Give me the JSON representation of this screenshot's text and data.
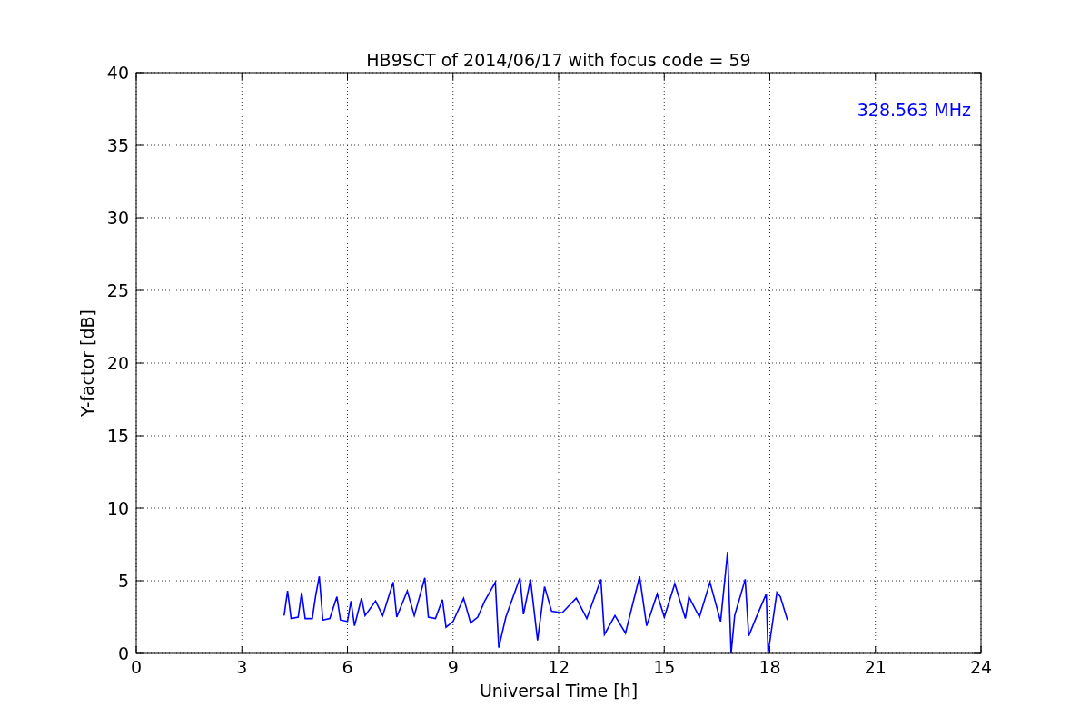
{
  "figure": {
    "chart_data": {
      "type": "line",
      "title": "HB9SCT of 2014/06/17 with focus code = 59",
      "xlabel": "Universal Time [h]",
      "ylabel": "Y-factor [dB]",
      "xlim": [
        0,
        24
      ],
      "ylim": [
        0,
        40
      ],
      "xticks": [
        0,
        3,
        6,
        9,
        12,
        15,
        18,
        21,
        24
      ],
      "yticks": [
        0,
        5,
        10,
        15,
        20,
        25,
        30,
        35,
        40
      ],
      "x": [
        4.2,
        4.3,
        4.4,
        4.6,
        4.7,
        4.8,
        5.0,
        5.1,
        5.2,
        5.3,
        5.5,
        5.7,
        5.8,
        6.0,
        6.1,
        6.2,
        6.4,
        6.5,
        6.8,
        7.0,
        7.3,
        7.4,
        7.7,
        7.9,
        8.2,
        8.3,
        8.5,
        8.7,
        8.8,
        9.0,
        9.3,
        9.5,
        9.7,
        9.9,
        10.2,
        10.3,
        10.5,
        10.9,
        11.0,
        11.2,
        11.4,
        11.6,
        11.8,
        12.1,
        12.5,
        12.8,
        13.2,
        13.3,
        13.6,
        13.9,
        14.3,
        14.5,
        14.8,
        15.0,
        15.3,
        15.6,
        15.7,
        16.0,
        16.3,
        16.6,
        16.8,
        16.9,
        17.0,
        17.3,
        17.4,
        17.6,
        17.9,
        17.95,
        18.1,
        18.2,
        18.3,
        18.5
      ],
      "series": [
        {
          "name": "328.563 MHz",
          "color": "#0000ff",
          "values": [
            2.6,
            4.3,
            2.4,
            2.5,
            4.2,
            2.4,
            2.4,
            4.0,
            5.3,
            2.3,
            2.4,
            3.9,
            2.3,
            2.2,
            3.6,
            1.9,
            3.8,
            2.6,
            3.6,
            2.6,
            4.9,
            2.5,
            4.3,
            2.6,
            5.2,
            2.5,
            2.4,
            3.7,
            1.8,
            2.2,
            3.8,
            2.1,
            2.5,
            3.6,
            4.9,
            0.4,
            2.5,
            5.2,
            2.7,
            5.1,
            0.9,
            4.6,
            2.9,
            2.8,
            3.8,
            2.4,
            5.1,
            1.3,
            2.6,
            1.4,
            5.3,
            1.9,
            4.1,
            2.5,
            4.8,
            2.4,
            3.9,
            2.5,
            4.9,
            2.2,
            7.0,
            0.0,
            2.6,
            5.1,
            1.2,
            2.4,
            4.1,
            0.0,
            2.5,
            4.2,
            3.9,
            2.3
          ]
        }
      ],
      "grid": true
    }
  }
}
